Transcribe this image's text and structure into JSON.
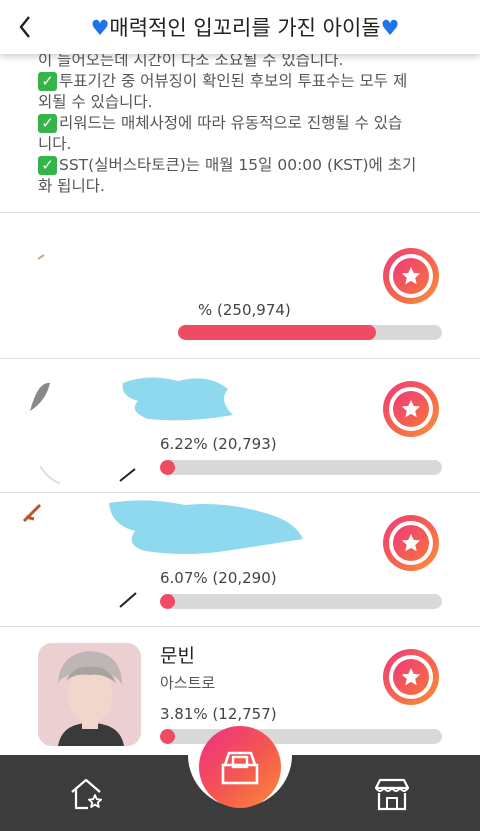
{
  "header": {
    "title": "매력적인 입꼬리를 가진 아이돌",
    "heart_color": "#1e74e8"
  },
  "notice": {
    "line0": "이 늘어오는데 시간이 다소 소요될 수 있습니다.",
    "line1a": "투표기간 중 어뷰징이 확인된 후보의 투표수는 모두 제",
    "line1b": "외될 수 있습니다.",
    "line2a": "리워드는 매체사정에 따라 유동적으로 진행될 수 있습",
    "line2b": "니다.",
    "line3a": "SST(실버스타토큰)는 매월 15일 00:00 (KST)에 초기",
    "line3b": "화 됩니다.",
    "check_glyph": "✓"
  },
  "ranking": [
    {
      "name": "",
      "group": "",
      "stat": "% (250,974)",
      "fraction": 0.75
    },
    {
      "name": "",
      "group": "",
      "stat": "6.22% (20,793)",
      "fraction": 0.04
    },
    {
      "name": "",
      "group": "",
      "stat": "6.07% (20,290)",
      "fraction": 0.04
    },
    {
      "name": "문빈",
      "group": "아스트로",
      "stat": "3.81% (12,757)",
      "fraction": 0.03
    }
  ],
  "colors": {
    "accent": "#ef4b63",
    "bar_track": "#d9d9d9",
    "footer": "#3c3c3c",
    "scribble": "#8fd9ef"
  },
  "nav": {
    "left_icon": "home-star-icon",
    "center_icon": "ballot-box-icon",
    "right_icon": "store-icon"
  }
}
